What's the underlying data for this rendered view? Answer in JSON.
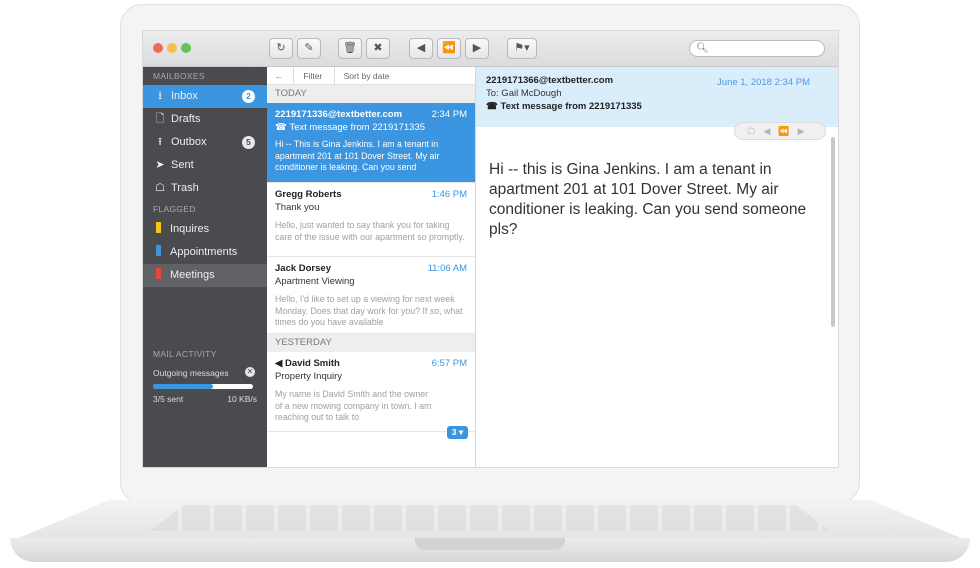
{
  "toolbar": {
    "dots": [
      {
        "name": "close",
        "color": "#ec6b5f"
      },
      {
        "name": "minimize",
        "color": "#f4bf4f"
      },
      {
        "name": "zoom",
        "color": "#61c454"
      }
    ],
    "search_placeholder": ""
  },
  "sidebar": {
    "mailboxes_heading": "MAILBOXES",
    "mailboxes": [
      {
        "icon": "inbox-icon",
        "label": "Inbox",
        "badge": "2"
      },
      {
        "icon": "drafts-icon",
        "label": "Drafts",
        "badge": ""
      },
      {
        "icon": "outbox-icon",
        "label": "Outbox",
        "badge": "5"
      },
      {
        "icon": "sent-icon",
        "label": "Sent",
        "badge": ""
      },
      {
        "icon": "trash-icon",
        "label": "Trash",
        "badge": ""
      }
    ],
    "flagged_heading": "FLAGGED",
    "flagged": [
      {
        "label": "Inquires",
        "color": "#f5c518"
      },
      {
        "label": "Appointments",
        "color": "#3b95e0"
      },
      {
        "label": "Meetings",
        "color": "#e8453c"
      }
    ],
    "activity_heading": "MAIL ACTIVITY",
    "activity": {
      "label": "Outgoing messages",
      "progress": 0.6,
      "sent_text": "3/5 sent",
      "speed": "10 KB/s"
    }
  },
  "list": {
    "filter_label": "Filter",
    "sort_label": "Sort by date",
    "today_label": "TODAY",
    "yesterday_label": "YESTERDAY",
    "messages": [
      {
        "sender": "2219171336@textbetter.com",
        "time": "2:34 PM",
        "subject": "Text message from 2219171335",
        "preview": "Hi -- This is Gina Jenkins. I am a tenant in apartment 201 at 101 Dover Street. My air conditioner is leaking. Can you send"
      },
      {
        "sender": "Gregg Roberts",
        "time": "1:46 PM",
        "subject": "Thank you",
        "preview": "Hello, just wanted to say thank you for taking care of the issue with our apartment so promptly."
      },
      {
        "sender": "Jack Dorsey",
        "time": "11:06 AM",
        "subject": "Apartment Viewing",
        "preview": "Hello, I'd like to set up a viewing for next week Monday. Does that day work for you? If so, what times do you have available"
      },
      {
        "sender": "David Smith",
        "time": "6:57 PM",
        "subject": "Property Inquiry",
        "preview": "My name is David Smith and the owner of a new mowing company in town. I am reaching out to talk to",
        "thread_count": "3"
      }
    ]
  },
  "reader": {
    "from": "2219171366@textbetter.com",
    "to": "To: Gail McDough",
    "subject": "Text message from 2219171335",
    "date": "June 1, 2018 2:34 PM",
    "body": "Hi -- this is Gina Jenkins. I am a tenant in apartment 201 at 101 Dover Street. My air conditioner is leaking. Can you send someone pls?"
  }
}
